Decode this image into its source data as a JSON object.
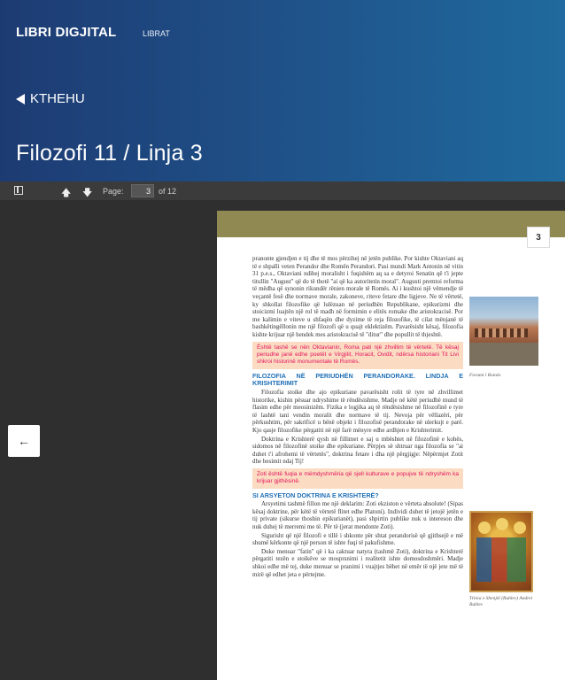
{
  "header": {
    "brand": "LIBRI DIGJITAL",
    "nav_librat": "LIBRAT",
    "back_label": "KTHEHU",
    "title": "Filozofi 11 / Linja 3"
  },
  "toolbar": {
    "page_label": "Page:",
    "page_value": "3",
    "page_total": "of 12"
  },
  "document": {
    "page_number": "3",
    "para1": "pranonte gjendjen e tij dhe të mos përzihej në jetën publike. Por kishte Oktaviani aq të e shpalli veten Perandor dhe Romën Perandori. Pasi mundi Mark Antonin në vitin 31 p.e.s., Oktaviani ndihej moralisht i fuqishëm aq sa e detyroi Senatin që t'i jepte titullin \"August\" që do të thotë \"ai që ka autoritetin moral\". Augusti premtoi reforma të mëdha që synonin rikundër rënien morale të Romës. Ai i kushtoi një vëmendje të veçantë fesë dhe normave morale, zakoneve, riteve fetare dhe ligjeve. Ne të vërtetë, ky shkollat filozofike që lulëzuan në periudhën Republikane, epikurizmi dhe stoicizmi luajtën një rol të madh në formimin e elitës romake dhe aristokracisë. Por me kalimin e viteve u shfaqën dhe dyzime të reja filozofike, të cilat mënjanë të bashkëtingëllonin me një filozofi që u quajt eklektizëm. Pavarësisht kësaj, filozofia kishte krijuar një hendek mes aristokracisë të \"ditur\" dhe popullit të thjeshtë.",
    "note1": "Është tashë se nën Oktavianin, Roma pati një zhvillim të vërtetë. Të kësaj periudhe janë edhe poetët e Virgjilit, Horacit, Ovidit, ndërsa historiani Tit Livi shkroi historinë monumentale të Romës.",
    "heading1": "FILOZOFIA NË PERIUDHËN PERANDORAKE. LINDJA E KRISHTERIMIT",
    "para2": "Filozofia stoike dhe ajo epikuriane pavarësisht rolit të tyre në zhvillimet historike, kishin pësuar ndryshime të rëndësishme. Madje në këtë periudhë mund të flasim edhe për meosinizëm. Fizika e logjika aq të rëndësishme në filozofinë e tyre të lashtë tani vendin moralit dhe normave të tij. Nevoja për vëllazëri, për përkushtim, për sakrificë u bënë objekt i filozofisë perandorake në ulerkujt e parë. Kjo qasje filozofike përgatiti në një farë mënyre edhe ardhjen e Krishterimit.",
    "para3": "Doktrina e Krishterë qysh në fillimet e saj u mbështet në filozofinë e kohës, sidomos në filozofinë stoike dhe epikuriane. Përpjes së shtruar nga filozofia se \"ai duhet t'i afrohemi të vërtetës\", doktrina fetare i dha një përgjigje: Nëpërmjet Zotit dhe besimit ndaj Tij!",
    "note2": "Zoti është fuqia e mëmdyshmëria që sjell kulturave e popujve të ndryshëm ka krijuar gjithësinë.",
    "heading2": "SI ARSYETON DOKTRINA E KRISHTERË?",
    "para4": "Arsyetimi tashmë fillon me një deklarim: Zoti ekziston e vërteta absolute! (Sipas kësaj doktrine, për këtë të vërtetë flitet edhe Platoni). Individi duhet të jetojë jetën e tij private (sikurse thoshin epikurianët), pasi shpirtin publike nuk u intereson dhe nuk duhej të merremi me të. Për të (jerat mendonte Zoti).",
    "para5": "Sigurisht që një filozofi e tillë i shkonte për shtat perandorisë që gjithsejë e më shumë kërkonte që një person të ishte fuqi të pakufishme.",
    "para6": "Duke menuar \"fatin\" që i ka caktuar natyra (tashmë Zoti), doktrina e Krishterë përgatiti tezën e stoikëve se mosprsnimi i realitetit ishte domosdoshmëri. Madje shkoi edhe më tej, duke menuar se pranimi i vuajtjes bëhet në emër të një jete më të mirë që edhet jeta e përtejme.",
    "caption1": "Forumi i Romës",
    "caption2": "Trinia e Shenjtë (Rublev) Andrei Rublev"
  }
}
